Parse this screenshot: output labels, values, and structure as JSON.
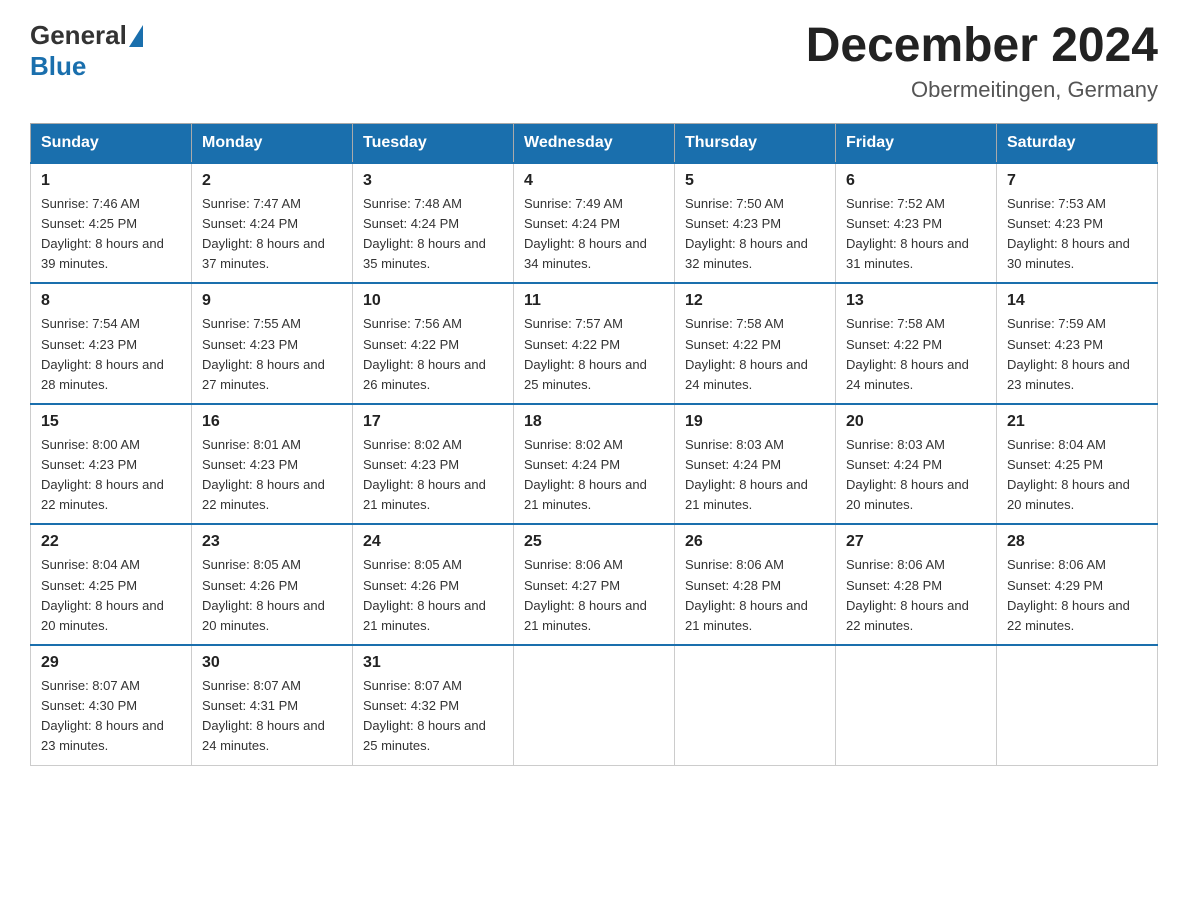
{
  "logo": {
    "general": "General",
    "blue": "Blue"
  },
  "title": {
    "month": "December 2024",
    "location": "Obermeitingen, Germany"
  },
  "weekdays": [
    "Sunday",
    "Monday",
    "Tuesday",
    "Wednesday",
    "Thursday",
    "Friday",
    "Saturday"
  ],
  "weeks": [
    [
      {
        "day": "1",
        "sunrise": "7:46 AM",
        "sunset": "4:25 PM",
        "daylight": "8 hours and 39 minutes."
      },
      {
        "day": "2",
        "sunrise": "7:47 AM",
        "sunset": "4:24 PM",
        "daylight": "8 hours and 37 minutes."
      },
      {
        "day": "3",
        "sunrise": "7:48 AM",
        "sunset": "4:24 PM",
        "daylight": "8 hours and 35 minutes."
      },
      {
        "day": "4",
        "sunrise": "7:49 AM",
        "sunset": "4:24 PM",
        "daylight": "8 hours and 34 minutes."
      },
      {
        "day": "5",
        "sunrise": "7:50 AM",
        "sunset": "4:23 PM",
        "daylight": "8 hours and 32 minutes."
      },
      {
        "day": "6",
        "sunrise": "7:52 AM",
        "sunset": "4:23 PM",
        "daylight": "8 hours and 31 minutes."
      },
      {
        "day": "7",
        "sunrise": "7:53 AM",
        "sunset": "4:23 PM",
        "daylight": "8 hours and 30 minutes."
      }
    ],
    [
      {
        "day": "8",
        "sunrise": "7:54 AM",
        "sunset": "4:23 PM",
        "daylight": "8 hours and 28 minutes."
      },
      {
        "day": "9",
        "sunrise": "7:55 AM",
        "sunset": "4:23 PM",
        "daylight": "8 hours and 27 minutes."
      },
      {
        "day": "10",
        "sunrise": "7:56 AM",
        "sunset": "4:22 PM",
        "daylight": "8 hours and 26 minutes."
      },
      {
        "day": "11",
        "sunrise": "7:57 AM",
        "sunset": "4:22 PM",
        "daylight": "8 hours and 25 minutes."
      },
      {
        "day": "12",
        "sunrise": "7:58 AM",
        "sunset": "4:22 PM",
        "daylight": "8 hours and 24 minutes."
      },
      {
        "day": "13",
        "sunrise": "7:58 AM",
        "sunset": "4:22 PM",
        "daylight": "8 hours and 24 minutes."
      },
      {
        "day": "14",
        "sunrise": "7:59 AM",
        "sunset": "4:23 PM",
        "daylight": "8 hours and 23 minutes."
      }
    ],
    [
      {
        "day": "15",
        "sunrise": "8:00 AM",
        "sunset": "4:23 PM",
        "daylight": "8 hours and 22 minutes."
      },
      {
        "day": "16",
        "sunrise": "8:01 AM",
        "sunset": "4:23 PM",
        "daylight": "8 hours and 22 minutes."
      },
      {
        "day": "17",
        "sunrise": "8:02 AM",
        "sunset": "4:23 PM",
        "daylight": "8 hours and 21 minutes."
      },
      {
        "day": "18",
        "sunrise": "8:02 AM",
        "sunset": "4:24 PM",
        "daylight": "8 hours and 21 minutes."
      },
      {
        "day": "19",
        "sunrise": "8:03 AM",
        "sunset": "4:24 PM",
        "daylight": "8 hours and 21 minutes."
      },
      {
        "day": "20",
        "sunrise": "8:03 AM",
        "sunset": "4:24 PM",
        "daylight": "8 hours and 20 minutes."
      },
      {
        "day": "21",
        "sunrise": "8:04 AM",
        "sunset": "4:25 PM",
        "daylight": "8 hours and 20 minutes."
      }
    ],
    [
      {
        "day": "22",
        "sunrise": "8:04 AM",
        "sunset": "4:25 PM",
        "daylight": "8 hours and 20 minutes."
      },
      {
        "day": "23",
        "sunrise": "8:05 AM",
        "sunset": "4:26 PM",
        "daylight": "8 hours and 20 minutes."
      },
      {
        "day": "24",
        "sunrise": "8:05 AM",
        "sunset": "4:26 PM",
        "daylight": "8 hours and 21 minutes."
      },
      {
        "day": "25",
        "sunrise": "8:06 AM",
        "sunset": "4:27 PM",
        "daylight": "8 hours and 21 minutes."
      },
      {
        "day": "26",
        "sunrise": "8:06 AM",
        "sunset": "4:28 PM",
        "daylight": "8 hours and 21 minutes."
      },
      {
        "day": "27",
        "sunrise": "8:06 AM",
        "sunset": "4:28 PM",
        "daylight": "8 hours and 22 minutes."
      },
      {
        "day": "28",
        "sunrise": "8:06 AM",
        "sunset": "4:29 PM",
        "daylight": "8 hours and 22 minutes."
      }
    ],
    [
      {
        "day": "29",
        "sunrise": "8:07 AM",
        "sunset": "4:30 PM",
        "daylight": "8 hours and 23 minutes."
      },
      {
        "day": "30",
        "sunrise": "8:07 AM",
        "sunset": "4:31 PM",
        "daylight": "8 hours and 24 minutes."
      },
      {
        "day": "31",
        "sunrise": "8:07 AM",
        "sunset": "4:32 PM",
        "daylight": "8 hours and 25 minutes."
      },
      null,
      null,
      null,
      null
    ]
  ]
}
